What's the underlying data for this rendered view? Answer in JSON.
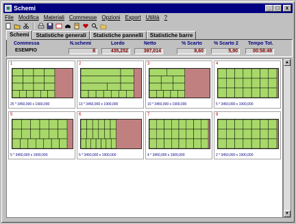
{
  "window": {
    "title": "Schemi"
  },
  "titlebar_buttons": [
    "_",
    "□",
    "x"
  ],
  "menu": [
    "File",
    "Modifica",
    "Materiali",
    "Commesse",
    "Opzioni",
    "Export",
    "Utilità",
    "?"
  ],
  "toolbar": [
    "new-icon",
    "open-icon",
    "cut-icon",
    "print-icon",
    "save-icon",
    "image-icon",
    "binoculars-icon",
    "document-icon",
    "heart-icon",
    "search-icon",
    "folder-icon"
  ],
  "tabs": [
    "Schemi",
    "Statistiche generali",
    "Statistiche pannelli",
    "Statistiche barre"
  ],
  "active_tab": "Schemi",
  "summary": {
    "headers": {
      "commessa": "Commessa",
      "n_schemi": "N.schemi",
      "lordo": "Lordo",
      "netto": "Netto",
      "scarto": "% Scarto",
      "scarto2": "% Scarto 2",
      "tempo": "Tempo Tot."
    },
    "values": {
      "commessa": "ESEMPIO",
      "n_schemi": "8",
      "lordo": "435,252",
      "netto": "397,014",
      "scarto": "8,60",
      "scarto2": "5,90",
      "tempo": "00:58:49"
    }
  },
  "schemes": [
    {
      "num": "1",
      "caption": "25 * 3450,000 x 1900,000"
    },
    {
      "num": "2",
      "caption": "13 * 3450,000 x 1900,000"
    },
    {
      "num": "3",
      "caption": "10 * 3450,000 x 1900,000"
    },
    {
      "num": "4",
      "caption": "5 * 3450,000 x 1900,000"
    },
    {
      "num": "5",
      "caption": "5 * 3450,000 x 1900,000"
    },
    {
      "num": "6",
      "caption": "5 * 3450,000 x 1900,000"
    },
    {
      "num": "7",
      "caption": "4 * 3450,000 x 1900,000"
    },
    {
      "num": "8",
      "caption": "2 * 3450,000 x 1900,000"
    }
  ],
  "colors": {
    "panel_green": "#a8d86a",
    "waste_red": "#c08080",
    "label_blue": "#000080",
    "number_red": "#c00000"
  }
}
